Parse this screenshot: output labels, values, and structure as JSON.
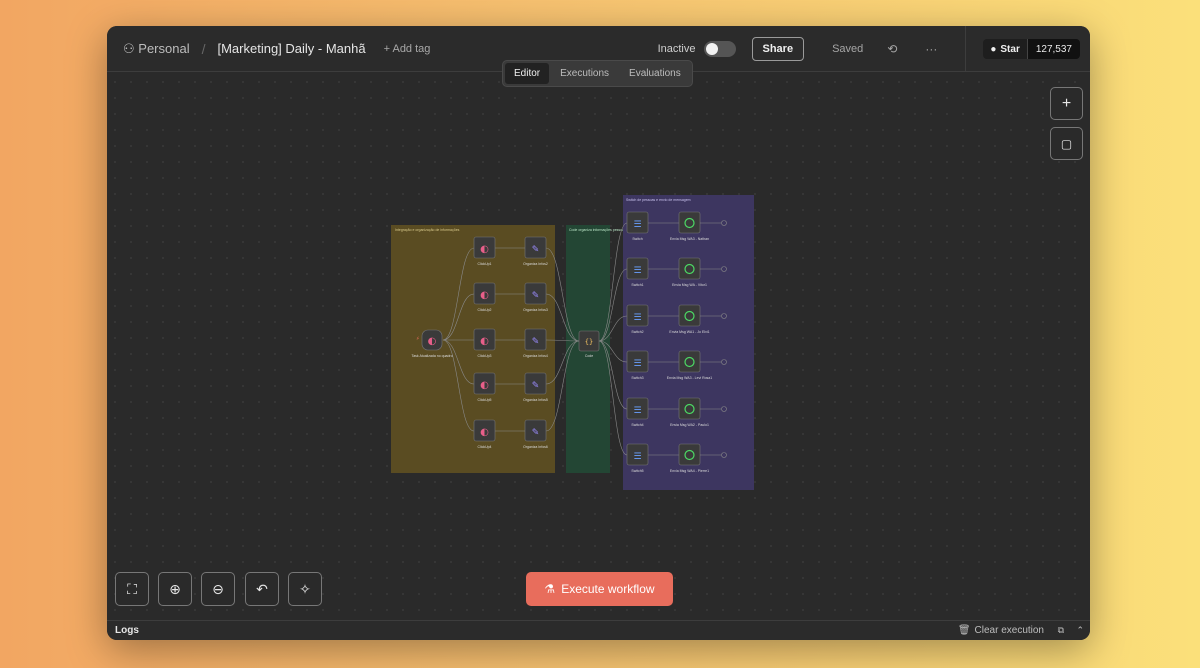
{
  "header": {
    "owner": "Personal",
    "workflow_title": "[Marketing] Daily - Manhã",
    "add_tag": "+ Add tag",
    "status_label": "Inactive",
    "share_label": "Share",
    "saved_label": "Saved",
    "github_star_label": "Star",
    "github_star_count": "127,537"
  },
  "tabs": [
    {
      "label": "Editor",
      "active": true
    },
    {
      "label": "Executions",
      "active": false
    },
    {
      "label": "Evaluations",
      "active": false
    }
  ],
  "execute_button": "Execute workflow",
  "logs": {
    "label": "Logs",
    "clear_label": "Clear execution"
  },
  "colors": {
    "accent": "#e86d5c",
    "sticky_yellow": "#5a4c22",
    "sticky_green": "#234634",
    "sticky_purple": "#3d3660"
  },
  "workflow": {
    "stickies": [
      {
        "label": "Integração e organização de informações"
      },
      {
        "label": "Code organiza informações pessoais e mensagem"
      },
      {
        "label": "Switch de pessoas e envio de mensagem"
      }
    ],
    "trigger": {
      "name": "Task Atualizada no quadro"
    },
    "clickup_nodes": [
      "ClickUp1",
      "ClickUp2",
      "ClickUp3",
      "ClickUp5",
      "ClickUp4"
    ],
    "organize_nodes": [
      "Organiza Infos2",
      "Organiza Infos3",
      "Organiza Infos4",
      "Organiza Infos5",
      "Organiza Infos6"
    ],
    "code_node": "Code",
    "switch_nodes": [
      "Switch",
      "Switch1",
      "Switch2",
      "Switch3",
      "Switch4",
      "Switch5"
    ],
    "send_nodes": [
      "Envia Msg WA3 - Nathan",
      "Envia Msg WA - Vitor1",
      "Envia Msg WA1 - Jo Elvi1",
      "Envia Msg WA3 - Levi Rosa1",
      "Envia Msg WA2 - Paulo1",
      "Envia Msg WA4 - Pierre1"
    ]
  }
}
